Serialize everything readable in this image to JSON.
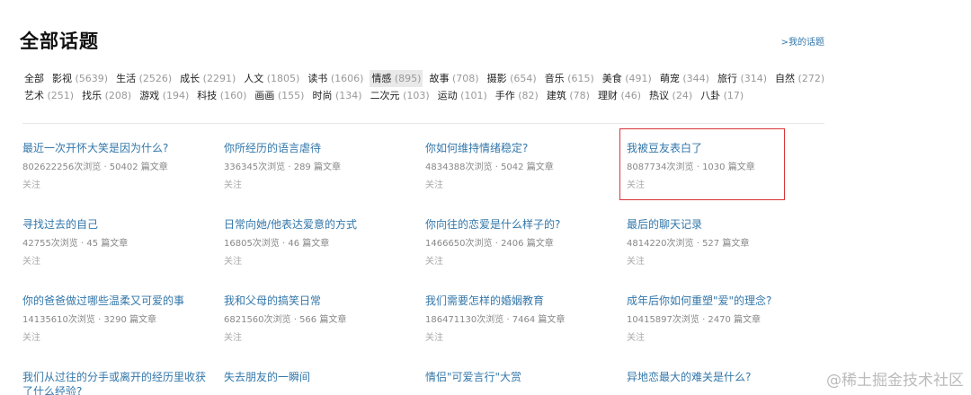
{
  "header": {
    "title": "全部话题",
    "my_topics_link": ">我的话题"
  },
  "categories": {
    "rows": [
      [
        {
          "label": "全部",
          "count": ""
        },
        {
          "label": "影视",
          "count": "(5639)"
        },
        {
          "label": "生活",
          "count": "(2526)"
        },
        {
          "label": "成长",
          "count": "(2291)"
        },
        {
          "label": "人文",
          "count": "(1805)"
        },
        {
          "label": "读书",
          "count": "(1606)"
        },
        {
          "label": "情感",
          "count": "(895)",
          "active": true
        },
        {
          "label": "故事",
          "count": "(708)"
        },
        {
          "label": "摄影",
          "count": "(654)"
        },
        {
          "label": "音乐",
          "count": "(615)"
        },
        {
          "label": "美食",
          "count": "(491)"
        },
        {
          "label": "萌宠",
          "count": "(344)"
        },
        {
          "label": "旅行",
          "count": "(314)"
        },
        {
          "label": "自然",
          "count": "(272)"
        }
      ],
      [
        {
          "label": "艺术",
          "count": "(251)"
        },
        {
          "label": "找乐",
          "count": "(208)"
        },
        {
          "label": "游戏",
          "count": "(194)"
        },
        {
          "label": "科技",
          "count": "(160)"
        },
        {
          "label": "画画",
          "count": "(155)"
        },
        {
          "label": "时尚",
          "count": "(134)"
        },
        {
          "label": "二次元",
          "count": "(103)"
        },
        {
          "label": "运动",
          "count": "(101)"
        },
        {
          "label": "手作",
          "count": "(82)"
        },
        {
          "label": "建筑",
          "count": "(78)"
        },
        {
          "label": "理财",
          "count": "(46)"
        },
        {
          "label": "热议",
          "count": "(24)"
        },
        {
          "label": "八卦",
          "count": "(17)"
        }
      ]
    ]
  },
  "topics": [
    {
      "title": "最近一次开怀大笑是因为什么?",
      "stats": "802622256次浏览 · 50402 篇文章",
      "follow": "关注"
    },
    {
      "title": "你所经历的语言虐待",
      "stats": "336345次浏览 · 289 篇文章",
      "follow": "关注"
    },
    {
      "title": "你如何维持情绪稳定?",
      "stats": "4834388次浏览 · 5042 篇文章",
      "follow": "关注"
    },
    {
      "title": "我被豆友表白了",
      "stats": "8087734次浏览 · 1030 篇文章",
      "follow": "关注"
    },
    {
      "title": "寻找过去的自己",
      "stats": "42755次浏览 · 45 篇文章",
      "follow": "关注"
    },
    {
      "title": "日常向她/他表达爱意的方式",
      "stats": "16805次浏览 · 46 篇文章",
      "follow": "关注"
    },
    {
      "title": "你向往的恋爱是什么样子的?",
      "stats": "1466650次浏览 · 2406 篇文章",
      "follow": "关注"
    },
    {
      "title": "最后的聊天记录",
      "stats": "4814220次浏览 · 527 篇文章",
      "follow": "关注"
    },
    {
      "title": "你的爸爸做过哪些温柔又可爱的事",
      "stats": "14135610次浏览 · 3290 篇文章",
      "follow": "关注"
    },
    {
      "title": "我和父母的搞笑日常",
      "stats": "6821560次浏览 · 566 篇文章",
      "follow": "关注"
    },
    {
      "title": "我们需要怎样的婚姻教育",
      "stats": "186471130次浏览 · 7464 篇文章",
      "follow": "关注"
    },
    {
      "title": "成年后你如何重塑\"爱\"的理念?",
      "stats": "10415897次浏览 · 2470 篇文章",
      "follow": "关注"
    },
    {
      "title": "我们从过往的分手或离开的经历里收获了什么经验?",
      "stats": "",
      "follow": ""
    },
    {
      "title": "失去朋友的一瞬间",
      "stats": "",
      "follow": ""
    },
    {
      "title": "情侣\"可爱言行\"大赏",
      "stats": "",
      "follow": ""
    },
    {
      "title": "异地恋最大的难关是什么?",
      "stats": "",
      "follow": ""
    }
  ],
  "watermark": "@稀土掘金技术社区",
  "colors": {
    "link": "#3377aa",
    "highlight_border": "#d9343a",
    "active_category_bg": "#e9e9e9"
  }
}
